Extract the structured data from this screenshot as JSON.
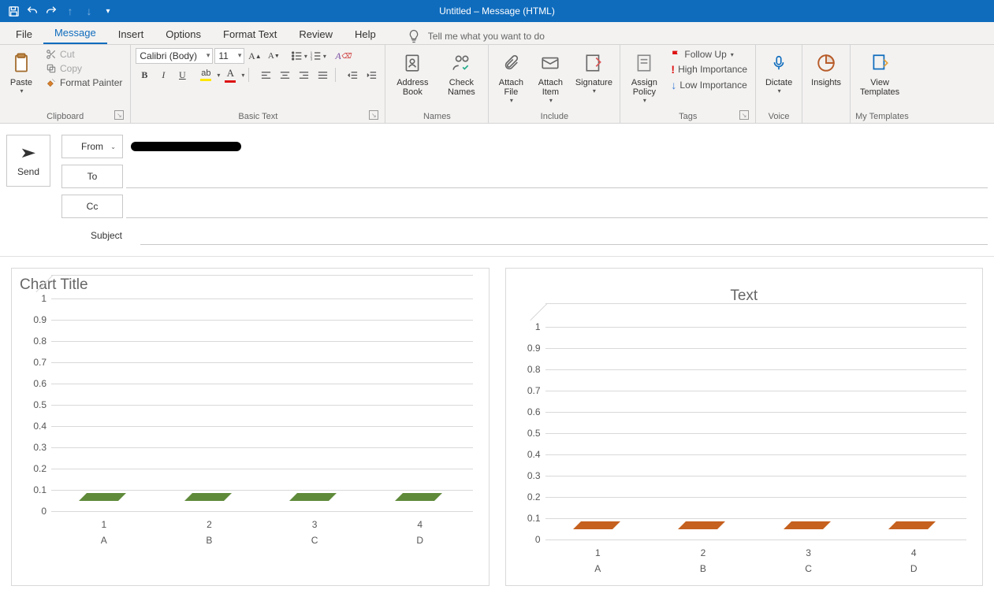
{
  "titlebar": {
    "title": "Untitled  –  Message (HTML)"
  },
  "qat": {
    "save": "save",
    "undo": "undo",
    "redo": "redo",
    "up": "up",
    "down": "down",
    "more": "more"
  },
  "tabs": [
    "File",
    "Message",
    "Insert",
    "Options",
    "Format Text",
    "Review",
    "Help"
  ],
  "tell_me_placeholder": "Tell me what you want to do",
  "clipboard": {
    "paste": "Paste",
    "cut": "Cut",
    "copy": "Copy",
    "format_painter": "Format Painter",
    "group_label": "Clipboard"
  },
  "basic_text": {
    "font_name": "Calibri (Body)",
    "font_size": "11",
    "group_label": "Basic Text"
  },
  "names": {
    "address_book": "Address Book",
    "check_names": "Check Names",
    "group_label": "Names"
  },
  "include": {
    "attach_file": "Attach File",
    "attach_item": "Attach Item",
    "signature": "Signature",
    "group_label": "Include"
  },
  "tags": {
    "assign_policy": "Assign Policy",
    "follow_up": "Follow Up",
    "high": "High Importance",
    "low": "Low Importance",
    "group_label": "Tags"
  },
  "voice": {
    "dictate": "Dictate",
    "group_label": "Voice"
  },
  "insights": {
    "label": "Insights"
  },
  "my_templates": {
    "view": "View Templates",
    "group_label": "My Templates"
  },
  "compose": {
    "send": "Send",
    "from": "From",
    "to": "To",
    "cc": "Cc",
    "subject": "Subject"
  },
  "chart_data": [
    {
      "type": "bar",
      "title": "Chart Title",
      "categories_num": [
        "1",
        "2",
        "3",
        "4"
      ],
      "categories_alpha": [
        "A",
        "B",
        "C",
        "D"
      ],
      "values": [
        0.06,
        0.06,
        0.06,
        0.06
      ],
      "ylim": [
        0,
        1
      ],
      "yticks": [
        0,
        0.1,
        0.2,
        0.3,
        0.4,
        0.5,
        0.6,
        0.7,
        0.8,
        0.9,
        1
      ],
      "color": "#5f8a3a"
    },
    {
      "type": "bar",
      "title": "Text",
      "categories_num": [
        "1",
        "2",
        "3",
        "4"
      ],
      "categories_alpha": [
        "A",
        "B",
        "C",
        "D"
      ],
      "values": [
        0.06,
        0.06,
        0.06,
        0.06
      ],
      "ylim": [
        0,
        1
      ],
      "yticks": [
        0,
        0.1,
        0.2,
        0.3,
        0.4,
        0.5,
        0.6,
        0.7,
        0.8,
        0.9,
        1
      ],
      "color": "#c5601e"
    }
  ]
}
